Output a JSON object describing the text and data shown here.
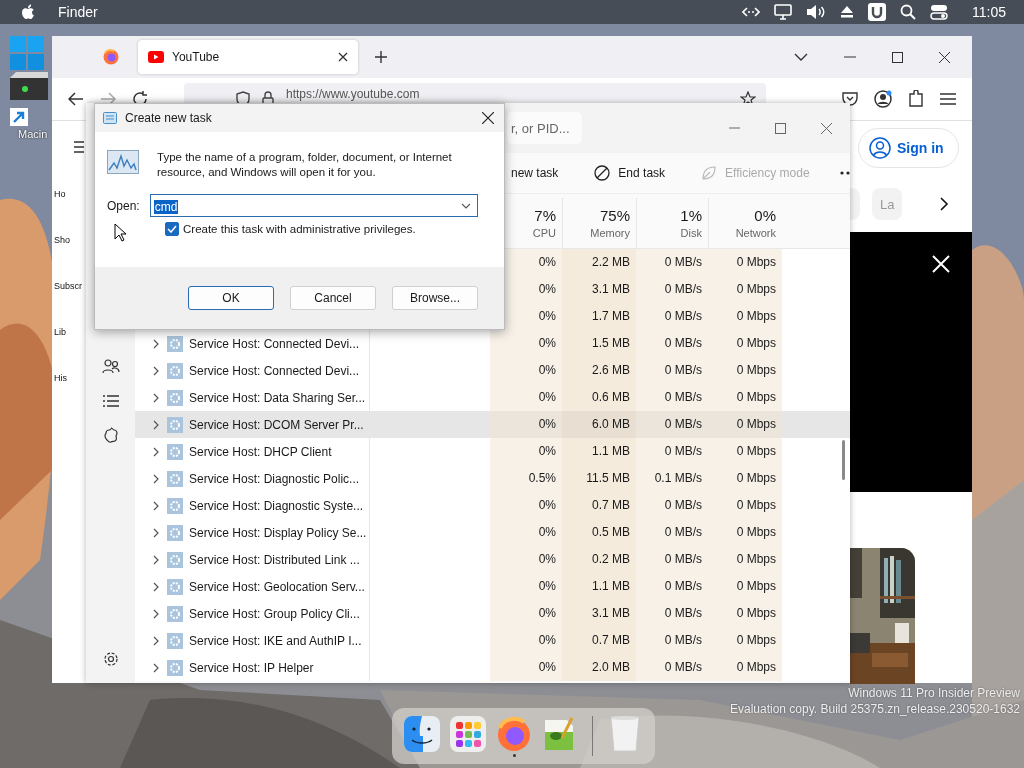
{
  "menu_bar": {
    "app": "Finder",
    "clock": "11:05"
  },
  "desktop_icons": [
    {
      "label": "Macin"
    }
  ],
  "browser": {
    "tabs": [
      {
        "label": "YouTube",
        "selected": true
      }
    ],
    "url": "https://www.youtube.com",
    "sidebar_labels": [
      "Ho",
      "Sho",
      "Subscr",
      "Lib",
      "His"
    ],
    "sign_in": "Sign in",
    "chips": [
      "La"
    ]
  },
  "task_manager": {
    "search_placeholder": "r, or PID...",
    "toolbar": [
      {
        "kind": "new",
        "label": "new task",
        "disabled": false
      },
      {
        "kind": "end",
        "label": "End task",
        "disabled": false
      },
      {
        "kind": "efficiency",
        "label": "Efficiency mode",
        "disabled": true
      }
    ],
    "columns": [
      {
        "percent": "7%",
        "label": "CPU"
      },
      {
        "percent": "75%",
        "label": "Memory"
      },
      {
        "percent": "1%",
        "label": "Disk"
      },
      {
        "percent": "0%",
        "label": "Network"
      }
    ],
    "rows": [
      {
        "cpu": "0%",
        "memory": "2.2 MB",
        "disk": "0 MB/s",
        "network": "0 Mbps"
      },
      {
        "cpu": "0%",
        "memory": "3.1 MB",
        "disk": "0 MB/s",
        "network": "0 Mbps"
      },
      {
        "cpu": "0%",
        "memory": "1.7 MB",
        "disk": "0 MB/s",
        "network": "0 Mbps"
      },
      {
        "name": "Service Host: Connected Devi...",
        "selected": false,
        "cpu": "0%",
        "memory": "1.5 MB",
        "disk": "0 MB/s",
        "network": "0 Mbps"
      },
      {
        "name": "Service Host: Connected Devi...",
        "selected": false,
        "cpu": "0%",
        "memory": "2.6 MB",
        "disk": "0 MB/s",
        "network": "0 Mbps"
      },
      {
        "name": "Service Host: Data Sharing Ser...",
        "selected": false,
        "cpu": "0%",
        "memory": "0.6 MB",
        "disk": "0 MB/s",
        "network": "0 Mbps"
      },
      {
        "name": "Service Host: DCOM Server Pr...",
        "selected": true,
        "cpu": "0%",
        "memory": "6.0 MB",
        "disk": "0 MB/s",
        "network": "0 Mbps"
      },
      {
        "name": "Service Host: DHCP Client",
        "selected": false,
        "cpu": "0%",
        "memory": "1.1 MB",
        "disk": "0 MB/s",
        "network": "0 Mbps"
      },
      {
        "name": "Service Host: Diagnostic Polic...",
        "selected": false,
        "cpu": "0.5%",
        "memory": "11.5 MB",
        "disk": "0.1 MB/s",
        "network": "0 Mbps"
      },
      {
        "name": "Service Host: Diagnostic Syste...",
        "selected": false,
        "cpu": "0%",
        "memory": "0.7 MB",
        "disk": "0 MB/s",
        "network": "0 Mbps"
      },
      {
        "name": "Service Host: Display Policy Se...",
        "selected": false,
        "cpu": "0%",
        "memory": "0.5 MB",
        "disk": "0 MB/s",
        "network": "0 Mbps"
      },
      {
        "name": "Service Host: Distributed Link ...",
        "selected": false,
        "cpu": "0%",
        "memory": "0.2 MB",
        "disk": "0 MB/s",
        "network": "0 Mbps"
      },
      {
        "name": "Service Host: Geolocation Serv...",
        "selected": false,
        "cpu": "0%",
        "memory": "1.1 MB",
        "disk": "0 MB/s",
        "network": "0 Mbps"
      },
      {
        "name": "Service Host: Group Policy Cli...",
        "selected": false,
        "cpu": "0%",
        "memory": "3.1 MB",
        "disk": "0 MB/s",
        "network": "0 Mbps"
      },
      {
        "name": "Service Host: IKE and AuthIP I...",
        "selected": false,
        "cpu": "0%",
        "memory": "0.7 MB",
        "disk": "0 MB/s",
        "network": "0 Mbps"
      },
      {
        "name": "Service Host: IP Helper",
        "selected": false,
        "cpu": "0%",
        "memory": "2.0 MB",
        "disk": "0 MB/s",
        "network": "0 Mbps"
      }
    ]
  },
  "dialog": {
    "title": "Create new task",
    "message": "Type the name of a program, folder, document, or Internet resource, and Windows will open it for you.",
    "open_label": "Open:",
    "value": "cmd",
    "value_selected": true,
    "checkbox": {
      "label": "Create this task with administrative privileges.",
      "checked": true
    },
    "buttons": [
      {
        "label": "OK",
        "default": true
      },
      {
        "label": "Cancel",
        "default": false
      },
      {
        "label": "Browse...",
        "default": false
      }
    ]
  },
  "desktop_notice": [
    "Windows 11 Pro Insider Preview",
    "Evaluation copy. Build 25375.zn_release.230520-1632"
  ],
  "dock": [
    {
      "kind": "finder",
      "running": false
    },
    {
      "kind": "launchpad",
      "running": false
    },
    {
      "kind": "browser",
      "running": true
    },
    {
      "kind": "editor",
      "running": false
    },
    {
      "kind": "trash",
      "running": false
    }
  ]
}
